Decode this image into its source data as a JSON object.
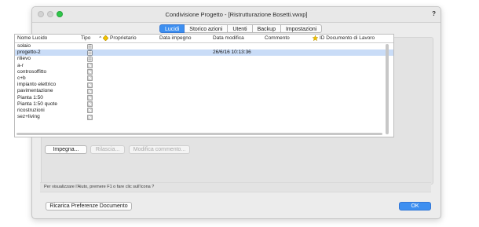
{
  "window": {
    "title": "Condivisione Progetto - [Ristrutturazione Bosetti.vwxp]",
    "help_label": "?"
  },
  "tabs": [
    {
      "label": "Lucidi",
      "active": true
    },
    {
      "label": "Storico azioni",
      "active": false
    },
    {
      "label": "Utenti",
      "active": false
    },
    {
      "label": "Backup",
      "active": false
    },
    {
      "label": "Impostazioni",
      "active": false
    }
  ],
  "table": {
    "columns": {
      "name": "Nome Lucido",
      "type": "Tipo",
      "sort_indicator": "⌃",
      "owner": "Proprietario",
      "checkout_date": "Data impegno",
      "modified_date": "Data modifica",
      "comment": "Commento",
      "job_id": "ID Documento di Lavoro"
    },
    "rows": [
      {
        "name": "solaio",
        "type_icon": "design-layer-icon",
        "modified": "",
        "selected": false
      },
      {
        "name": "progetto-2",
        "type_icon": "design-layer-icon",
        "modified": "26/6/16 10:13:36",
        "selected": true
      },
      {
        "name": "rilievo",
        "type_icon": "design-layer-icon",
        "modified": "",
        "selected": false
      },
      {
        "name": "a-r",
        "type_icon": "sheet-layer-icon",
        "modified": "",
        "selected": false
      },
      {
        "name": "controsoffitto",
        "type_icon": "sheet-layer-icon",
        "modified": "",
        "selected": false
      },
      {
        "name": "c+b",
        "type_icon": "sheet-layer-icon",
        "modified": "",
        "selected": false
      },
      {
        "name": "impianto elettrico",
        "type_icon": "sheet-layer-icon",
        "modified": "",
        "selected": false
      },
      {
        "name": "pavimentazione",
        "type_icon": "sheet-layer-icon",
        "modified": "",
        "selected": false
      },
      {
        "name": "Pianta 1:50",
        "type_icon": "sheet-layer-icon",
        "modified": "",
        "selected": false
      },
      {
        "name": "Pianta 1:50 quote",
        "type_icon": "sheet-layer-icon",
        "modified": "",
        "selected": false
      },
      {
        "name": "ricostruzioni",
        "type_icon": "sheet-layer-icon",
        "modified": "",
        "selected": false
      },
      {
        "name": "sez+living",
        "type_icon": "sheet-layer-icon",
        "modified": "",
        "selected": false
      }
    ]
  },
  "buttons": {
    "checkout": "Impegna...",
    "release": "Rilascia...",
    "edit_comment": "Modifica commento...",
    "reload_prefs": "Ricarica Preferenze Documento",
    "ok": "OK"
  },
  "info_text": "Per visualizzare l'Aiuto, premere F1 o fare clic sull'icona ?",
  "colors": {
    "accent": "#3d8ff0",
    "selection": "#c9dcf7",
    "star": "#f2c200"
  }
}
